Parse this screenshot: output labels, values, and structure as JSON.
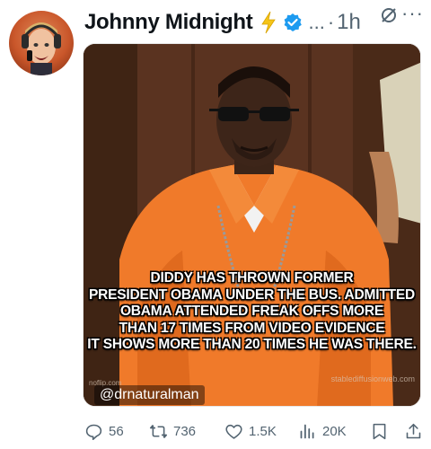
{
  "tweet": {
    "display_name": "Johnny Midnight",
    "truncation": "...",
    "separator": "·",
    "time": "1h",
    "more_label": "···"
  },
  "media": {
    "caption_lines": [
      "DIDDY HAS THROWN FORMER",
      "PRESIDENT OBAMA UNDER THE BUS. ADMITTED",
      "OBAMA ATTENDED FREAK OFFS MORE",
      "THAN 17 TIMES FROM VIDEO EVIDENCE",
      "IT SHOWS MORE THAN 20 TIMES HE WAS THERE."
    ],
    "handle_tag": "@drnaturalman",
    "watermark_left": "noflip.com",
    "watermark_right": "stablediffusionweb.com"
  },
  "actions": {
    "replies": "56",
    "reposts": "736",
    "likes": "1.5K",
    "views": "20K"
  },
  "colors": {
    "verified": "#1d9bf0",
    "bolt": "#f5c518",
    "muted": "#536471",
    "jumpsuit": "#f07a2a"
  },
  "icons": [
    "lightning-icon",
    "verified-badge-icon",
    "grok-icon",
    "more-icon",
    "reply-icon",
    "repost-icon",
    "like-icon",
    "views-icon",
    "bookmark-icon",
    "share-icon"
  ]
}
